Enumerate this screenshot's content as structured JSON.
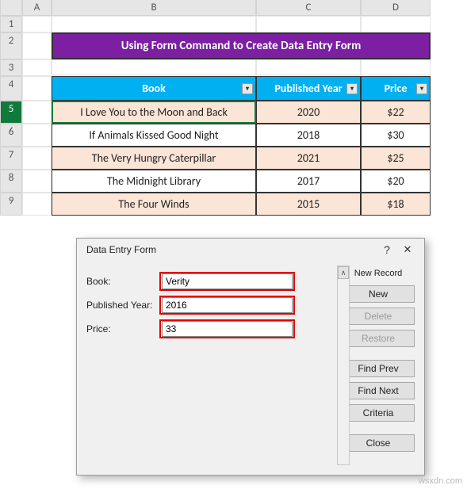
{
  "columns": [
    "",
    "A",
    "B",
    "C",
    "D"
  ],
  "rows": [
    "1",
    "2",
    "3",
    "4",
    "5",
    "6",
    "7",
    "8",
    "9"
  ],
  "selectedRow": "5",
  "title": "Using Form Command to Create Data Entry Form",
  "headers": {
    "book": "Book",
    "year": "Published Year",
    "price": "Price"
  },
  "data": [
    {
      "book": "I Love You to the Moon and Back",
      "year": "2020",
      "price": "$22"
    },
    {
      "book": "If Animals Kissed Good Night",
      "year": "2018",
      "price": "$30"
    },
    {
      "book": "The Very Hungry Caterpillar",
      "year": "2021",
      "price": "$25"
    },
    {
      "book": "The Midnight Library",
      "year": "2017",
      "price": "$20"
    },
    {
      "book": "The Four Winds",
      "year": "2015",
      "price": "$18"
    }
  ],
  "dialog": {
    "title": "Data Entry Form",
    "status": "New Record",
    "labels": {
      "book": "Book:",
      "year": "Published Year:",
      "price": "Price:"
    },
    "values": {
      "book": "Verity",
      "year": "2016",
      "price": "33"
    },
    "buttons": {
      "new": "New",
      "delete": "Delete",
      "restore": "Restore",
      "findPrev": "Find Prev",
      "findNext": "Find Next",
      "criteria": "Criteria",
      "close": "Close"
    }
  },
  "watermark": "wsxdn.com"
}
